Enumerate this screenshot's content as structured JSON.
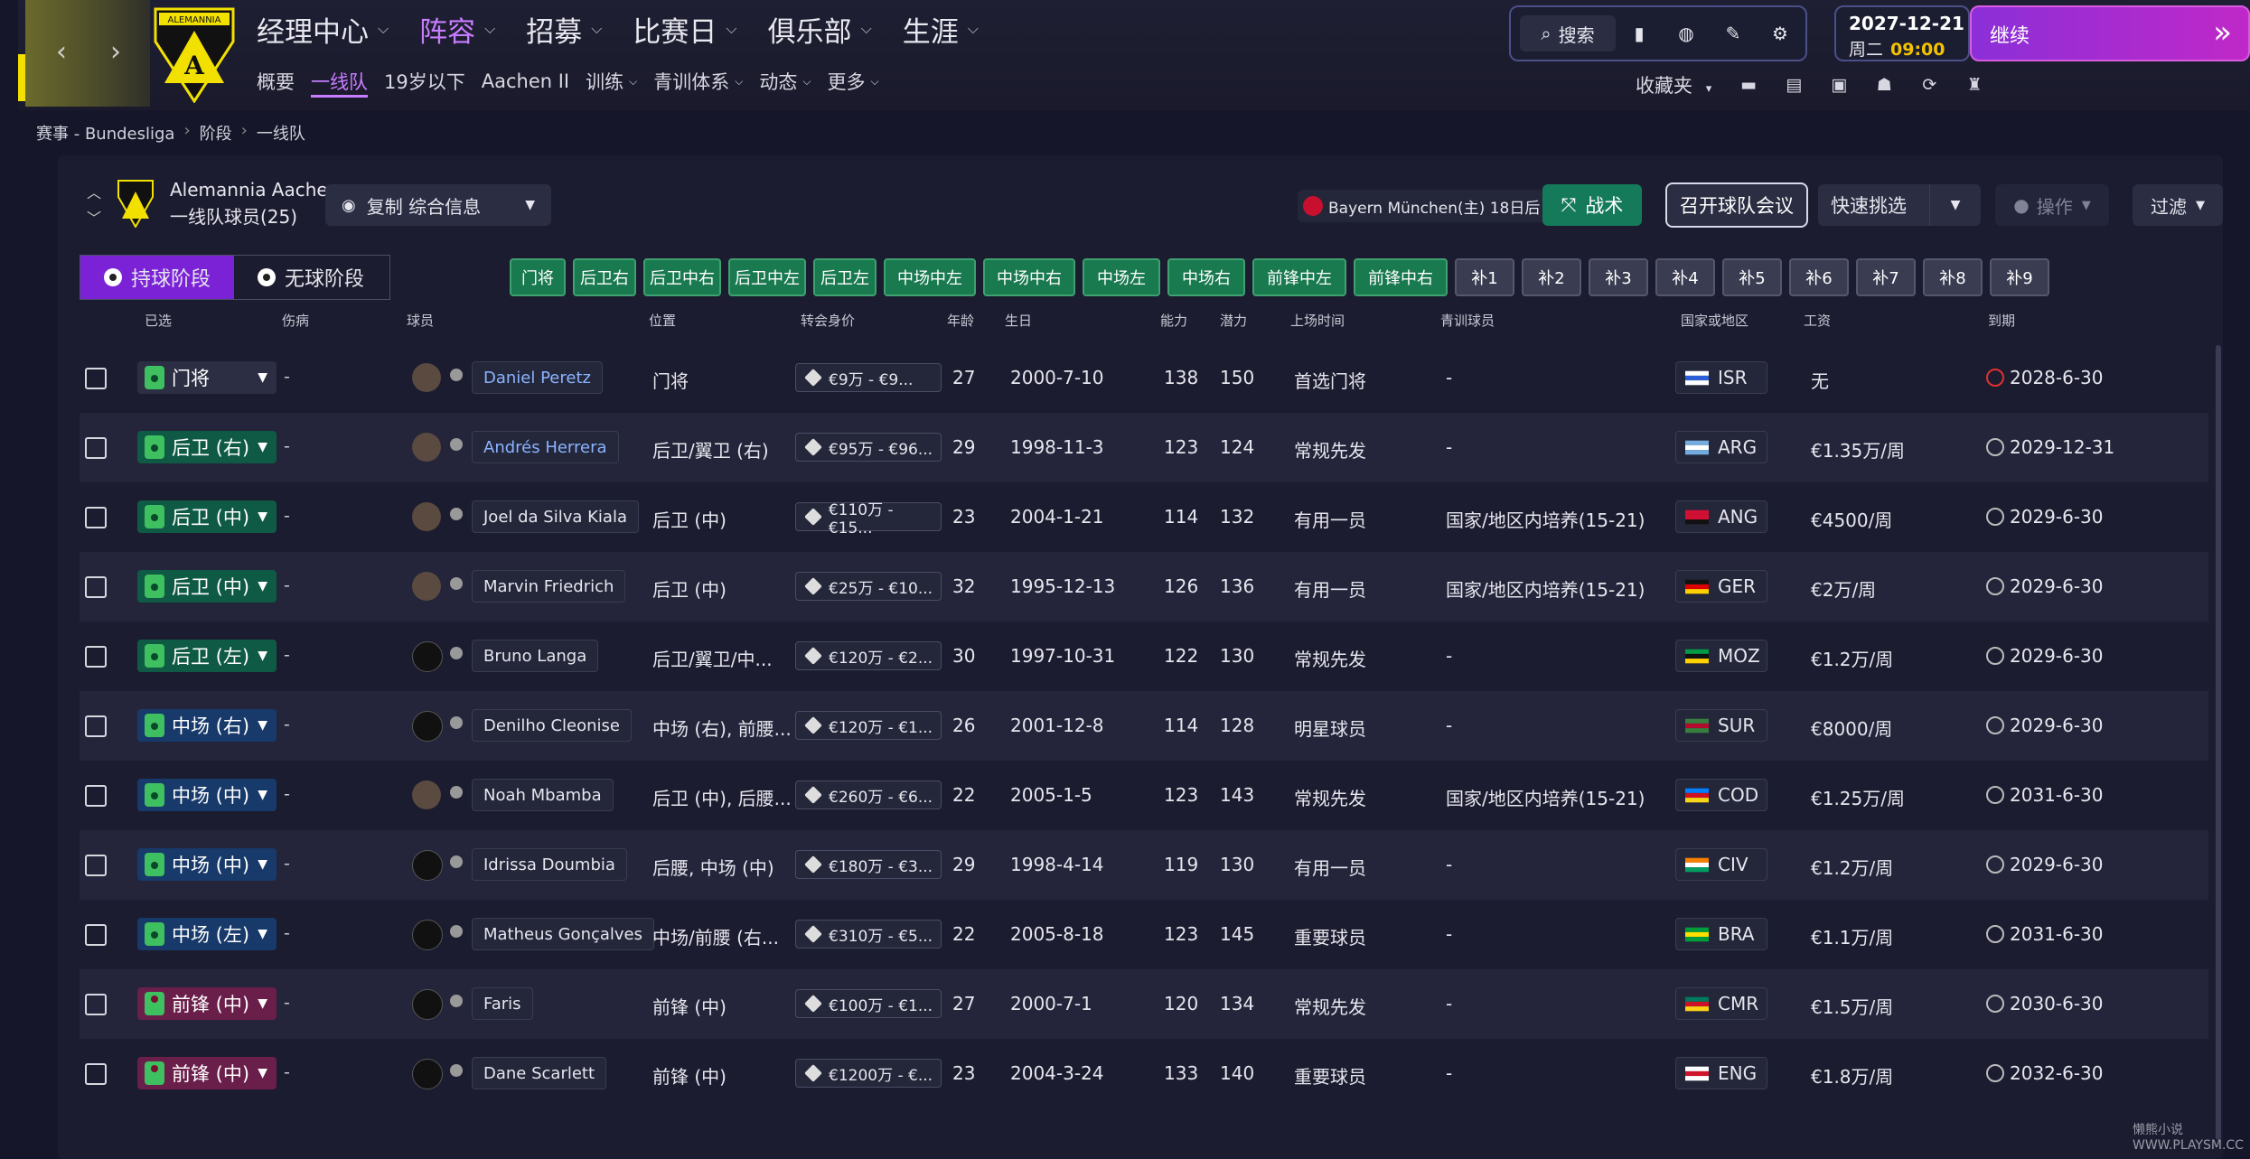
{
  "main_nav": [
    {
      "label": "经理中心",
      "active": false
    },
    {
      "label": "阵容",
      "active": true
    },
    {
      "label": "招募",
      "active": false
    },
    {
      "label": "比赛日",
      "active": false
    },
    {
      "label": "俱乐部",
      "active": false
    },
    {
      "label": "生涯",
      "active": false
    }
  ],
  "sub_nav": [
    {
      "label": "概要",
      "dropdown": false,
      "active": false
    },
    {
      "label": "一线队",
      "dropdown": false,
      "active": true
    },
    {
      "label": "19岁以下",
      "dropdown": false,
      "active": false
    },
    {
      "label": "Aachen II",
      "dropdown": false,
      "active": false
    },
    {
      "label": "训练",
      "dropdown": true,
      "active": false
    },
    {
      "label": "青训体系",
      "dropdown": true,
      "active": false
    },
    {
      "label": "动态",
      "dropdown": true,
      "active": false
    },
    {
      "label": "更多",
      "dropdown": true,
      "active": false
    }
  ],
  "toolbar": {
    "search_label": "搜索",
    "favorites_label": "收藏夹"
  },
  "date": {
    "date": "2027-12-21",
    "weekday": "周二",
    "time": "09:00"
  },
  "continue_label": "继续",
  "crest_text": "ALEMANNIA",
  "breadcrumb": [
    "赛事 - Bundesliga",
    "阶段",
    "一线队"
  ],
  "squad": {
    "team": "Alemannia Aachen",
    "subtitle": "一线队球员(25)",
    "view": "复制 综合信息"
  },
  "next_match": "Bayern München(主) 18日后",
  "buttons": {
    "tactics": "战术",
    "meeting": "召开球队会议",
    "quickpick": "快速挑选",
    "actions": "操作",
    "filter": "过滤"
  },
  "phase_tabs": [
    {
      "label": "持球阶段",
      "active": true
    },
    {
      "label": "无球阶段",
      "active": false
    }
  ],
  "position_chips": [
    {
      "label": "门将",
      "filled": true,
      "w": 58
    },
    {
      "label": "后卫右",
      "filled": true,
      "w": 66
    },
    {
      "label": "后卫中右",
      "filled": true,
      "w": 82
    },
    {
      "label": "后卫中左",
      "filled": true,
      "w": 82
    },
    {
      "label": "后卫左",
      "filled": true,
      "w": 66
    },
    {
      "label": "中场中左",
      "filled": true,
      "w": 98
    },
    {
      "label": "中场中右",
      "filled": true,
      "w": 98
    },
    {
      "label": "中场左",
      "filled": true,
      "w": 82
    },
    {
      "label": "中场右",
      "filled": true,
      "w": 82
    },
    {
      "label": "前锋中左",
      "filled": true,
      "w": 100
    },
    {
      "label": "前锋中右",
      "filled": true,
      "w": 100
    },
    {
      "label": "补1",
      "filled": false,
      "w": 62
    },
    {
      "label": "补2",
      "filled": false,
      "w": 62
    },
    {
      "label": "补3",
      "filled": false,
      "w": 62
    },
    {
      "label": "补4",
      "filled": false,
      "w": 62
    },
    {
      "label": "补5",
      "filled": false,
      "w": 62
    },
    {
      "label": "补6",
      "filled": false,
      "w": 62
    },
    {
      "label": "补7",
      "filled": false,
      "w": 62
    },
    {
      "label": "补8",
      "filled": false,
      "w": 62
    },
    {
      "label": "补9",
      "filled": false,
      "w": 62
    }
  ],
  "columns": [
    "已选",
    "伤病",
    "球员",
    "位置",
    "转会身价",
    "年龄",
    "生日",
    "能力",
    "潜力",
    "上场时间",
    "青训球员",
    "国家或地区",
    "工资",
    "到期"
  ],
  "players": [
    {
      "selected": "门将",
      "cat": "gk",
      "injury": "-",
      "name": "Daniel Peretz",
      "link": true,
      "pos": "门将",
      "value": "€9万 - €9...",
      "age": "27",
      "dob": "2000-7-10",
      "ca": "138",
      "pa": "150",
      "time": "首选门将",
      "hg": "-",
      "nat": "ISR",
      "wage": "无",
      "expiry": "2028-6-30",
      "exp_red": true
    },
    {
      "selected": "后卫 (右)",
      "cat": "df",
      "injury": "-",
      "name": "Andrés Herrera",
      "link": true,
      "pos": "后卫/翼卫 (右)",
      "value": "€95万 - €96...",
      "age": "29",
      "dob": "1998-11-3",
      "ca": "123",
      "pa": "124",
      "time": "常规先发",
      "hg": "-",
      "nat": "ARG",
      "wage": "€1.35万/周",
      "expiry": "2029-12-31",
      "exp_red": false
    },
    {
      "selected": "后卫 (中)",
      "cat": "df",
      "injury": "-",
      "name": "Joel da Silva Kiala",
      "link": false,
      "pos": "后卫 (中)",
      "value": "€110万 - €15...",
      "age": "23",
      "dob": "2004-1-21",
      "ca": "114",
      "pa": "132",
      "time": "有用一员",
      "hg": "国家/地区内培养(15-21)",
      "nat": "ANG",
      "wage": "€4500/周",
      "expiry": "2029-6-30",
      "exp_red": false
    },
    {
      "selected": "后卫 (中)",
      "cat": "df",
      "injury": "-",
      "name": "Marvin Friedrich",
      "link": false,
      "pos": "后卫 (中)",
      "value": "€25万 - €10...",
      "age": "32",
      "dob": "1995-12-13",
      "ca": "126",
      "pa": "136",
      "time": "有用一员",
      "hg": "国家/地区内培养(15-21)",
      "nat": "GER",
      "wage": "€2万/周",
      "expiry": "2029-6-30",
      "exp_red": false
    },
    {
      "selected": "后卫 (左)",
      "cat": "df",
      "injury": "-",
      "name": "Bruno Langa",
      "link": false,
      "pos": "后卫/翼卫/中...",
      "value": "€120万 - €2...",
      "age": "30",
      "dob": "1997-10-31",
      "ca": "122",
      "pa": "130",
      "time": "常规先发",
      "hg": "-",
      "nat": "MOZ",
      "wage": "€1.2万/周",
      "expiry": "2029-6-30",
      "exp_red": false
    },
    {
      "selected": "中场 (右)",
      "cat": "mf",
      "injury": "-",
      "name": "Denilho Cleonise",
      "link": false,
      "pos": "中场 (右), 前腰...",
      "value": "€120万 - €1...",
      "age": "26",
      "dob": "2001-12-8",
      "ca": "114",
      "pa": "128",
      "time": "明星球员",
      "hg": "-",
      "nat": "SUR",
      "wage": "€8000/周",
      "expiry": "2029-6-30",
      "exp_red": false
    },
    {
      "selected": "中场 (中)",
      "cat": "mf",
      "injury": "-",
      "name": "Noah Mbamba",
      "link": false,
      "pos": "后卫 (中), 后腰...",
      "value": "€260万 - €6...",
      "age": "22",
      "dob": "2005-1-5",
      "ca": "123",
      "pa": "143",
      "time": "常规先发",
      "hg": "国家/地区内培养(15-21)",
      "nat": "COD",
      "wage": "€1.25万/周",
      "expiry": "2031-6-30",
      "exp_red": false
    },
    {
      "selected": "中场 (中)",
      "cat": "mf",
      "injury": "-",
      "name": "Idrissa Doumbia",
      "link": false,
      "pos": "后腰, 中场 (中)",
      "value": "€180万 - €3...",
      "age": "29",
      "dob": "1998-4-14",
      "ca": "119",
      "pa": "130",
      "time": "有用一员",
      "hg": "-",
      "nat": "CIV",
      "wage": "€1.2万/周",
      "expiry": "2029-6-30",
      "exp_red": false
    },
    {
      "selected": "中场 (左)",
      "cat": "mf",
      "injury": "-",
      "name": "Matheus Gonçalves",
      "link": false,
      "pos": "中场/前腰 (右...",
      "value": "€310万 - €5...",
      "age": "22",
      "dob": "2005-8-18",
      "ca": "123",
      "pa": "145",
      "time": "重要球员",
      "hg": "-",
      "nat": "BRA",
      "wage": "€1.1万/周",
      "expiry": "2031-6-30",
      "exp_red": false
    },
    {
      "selected": "前锋 (中)",
      "cat": "fw",
      "injury": "-",
      "name": "Faris",
      "link": false,
      "pos": "前锋 (中)",
      "value": "€100万 - €1...",
      "age": "27",
      "dob": "2000-7-1",
      "ca": "120",
      "pa": "134",
      "time": "常规先发",
      "hg": "-",
      "nat": "CMR",
      "wage": "€1.5万/周",
      "expiry": "2030-6-30",
      "exp_red": false
    },
    {
      "selected": "前锋 (中)",
      "cat": "fw",
      "injury": "-",
      "name": "Dane Scarlett",
      "link": false,
      "pos": "前锋 (中)",
      "value": "€1200万 - €...",
      "age": "23",
      "dob": "2004-3-24",
      "ca": "133",
      "pa": "140",
      "time": "重要球员",
      "hg": "-",
      "nat": "ENG",
      "wage": "€1.8万/周",
      "expiry": "2032-6-30",
      "exp_red": false
    }
  ],
  "flags": {
    "ISR": [
      "#ffffff",
      "#2c5fd6",
      "#ffffff"
    ],
    "ARG": [
      "#74acdf",
      "#ffffff",
      "#74acdf"
    ],
    "ANG": [
      "#d21034",
      "#d21034",
      "#111111"
    ],
    "GER": [
      "#111111",
      "#dd0000",
      "#ffce00"
    ],
    "MOZ": [
      "#009a44",
      "#111111",
      "#ffd100"
    ],
    "SUR": [
      "#377e3f",
      "#b40a2d",
      "#377e3f"
    ],
    "COD": [
      "#007fff",
      "#ce1021",
      "#f7d618"
    ],
    "CIV": [
      "#f77f00",
      "#ffffff",
      "#009e60"
    ],
    "BRA": [
      "#009c3b",
      "#ffdf00",
      "#009c3b"
    ],
    "CMR": [
      "#007a5e",
      "#ce1126",
      "#fcd116"
    ],
    "ENG": [
      "#ffffff",
      "#cf142b",
      "#ffffff"
    ]
  },
  "accent": {
    "purple": "#7b22d6",
    "green": "#19794f",
    "link": "#8ab4ff"
  },
  "watermark": "懒熊小说 WWW.PLAYSM.CC"
}
